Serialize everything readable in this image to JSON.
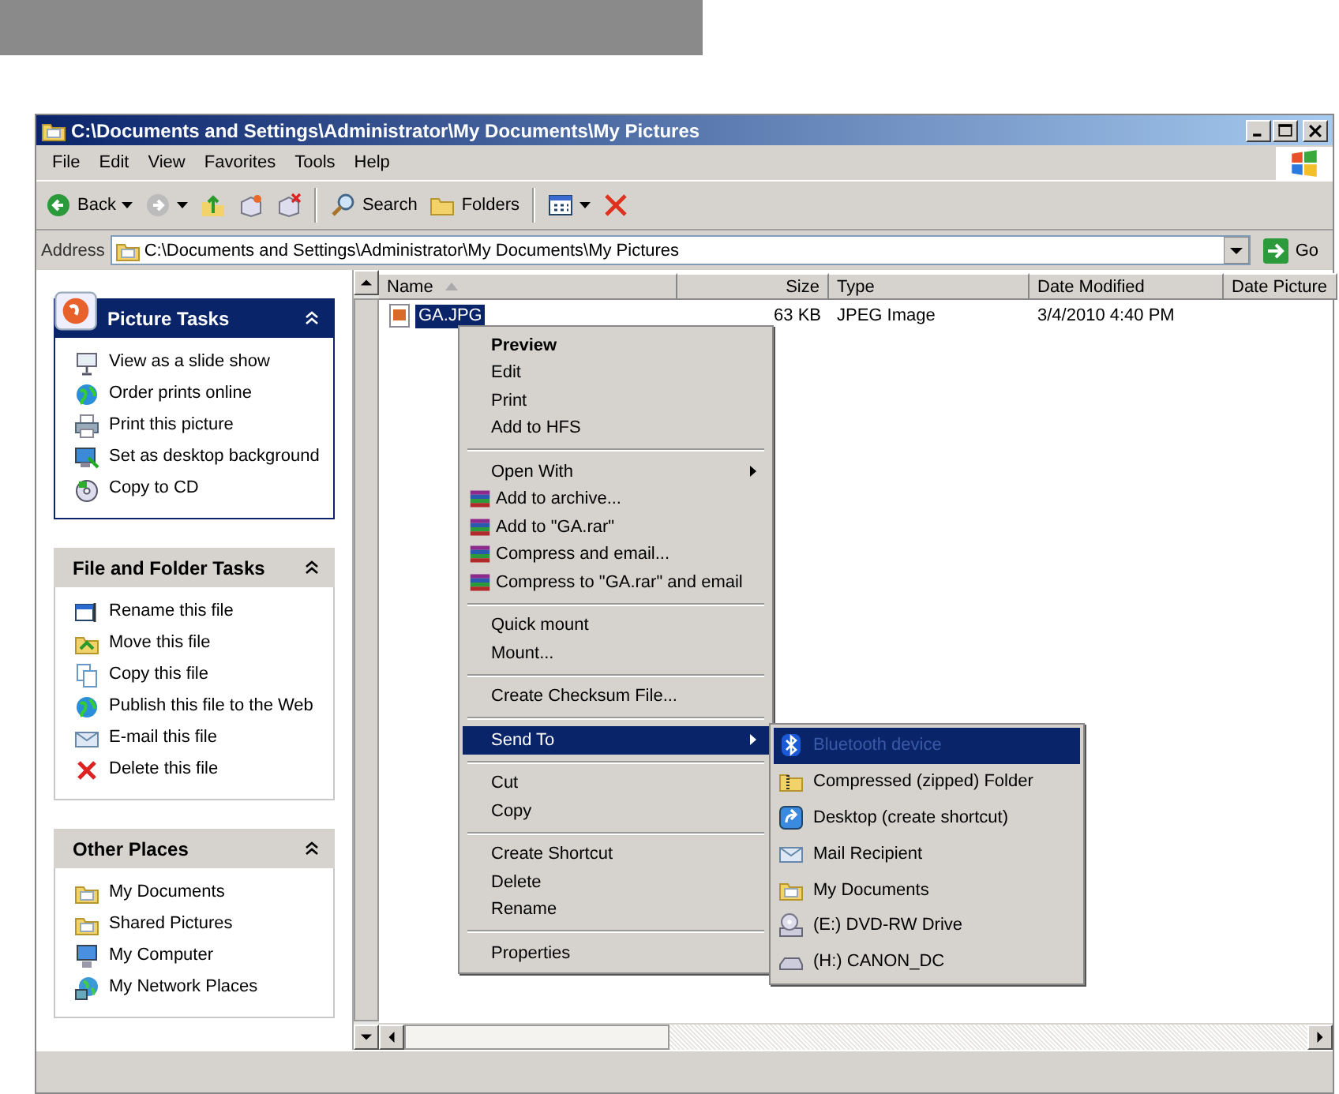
{
  "window": {
    "title": "C:\\Documents and Settings\\Administrator\\My Documents\\My Pictures"
  },
  "menu_bar": [
    "File",
    "Edit",
    "View",
    "Favorites",
    "Tools",
    "Help"
  ],
  "toolbar": [
    {
      "kind": "back",
      "label": "Back",
      "dropdown": true
    },
    {
      "kind": "forward",
      "dropdown": true
    },
    {
      "kind": "up"
    },
    {
      "kind": "move"
    },
    {
      "kind": "copyto"
    },
    {
      "kind": "separator"
    },
    {
      "kind": "search",
      "label": "Search"
    },
    {
      "kind": "folders",
      "label": "Folders"
    },
    {
      "kind": "separator"
    },
    {
      "kind": "views",
      "dropdown": true
    },
    {
      "kind": "delete"
    }
  ],
  "address_bar": {
    "label": "Address",
    "value": "C:\\Documents and Settings\\Administrator\\My Documents\\My Pictures",
    "go": "Go"
  },
  "task_panes": [
    {
      "title": "Picture Tasks",
      "kind": "special",
      "expanded": true,
      "items": [
        {
          "label": "View as a slide show",
          "kind": "slideshow"
        },
        {
          "label": "Order prints online",
          "kind": "globe"
        },
        {
          "label": "Print this picture",
          "kind": "print"
        },
        {
          "label": "Set as desktop background",
          "kind": "desktop"
        },
        {
          "label": "Copy to CD",
          "kind": "cd"
        }
      ]
    },
    {
      "title": "File and Folder Tasks",
      "kind": "normal",
      "expanded": true,
      "items": [
        {
          "label": "Rename this file",
          "kind": "rename"
        },
        {
          "label": "Move this file",
          "kind": "move"
        },
        {
          "label": "Copy this file",
          "kind": "copy"
        },
        {
          "label": "Publish this file to the Web",
          "kind": "globe"
        },
        {
          "label": "E-mail this file",
          "kind": "mail"
        },
        {
          "label": "Delete this file",
          "kind": "delete"
        }
      ]
    },
    {
      "title": "Other Places",
      "kind": "normal",
      "expanded": true,
      "items": [
        {
          "label": "My Documents",
          "kind": "folder"
        },
        {
          "label": "Shared Pictures",
          "kind": "folder"
        },
        {
          "label": "My Computer",
          "kind": "computer"
        },
        {
          "label": "My Network Places",
          "kind": "network"
        }
      ]
    }
  ],
  "file_list": {
    "columns": [
      {
        "label": "Name",
        "sorted": true
      },
      {
        "label": "Size",
        "sorted": false
      },
      {
        "label": "Type",
        "sorted": false
      },
      {
        "label": "Date Modified",
        "sorted": false
      },
      {
        "label": "Date Picture",
        "sorted": false
      }
    ],
    "rows": [
      {
        "name": "GA.JPG",
        "size": "63 KB",
        "type": "JPEG Image",
        "date_modified": "3/4/2010 4:40 PM",
        "selected": true
      }
    ]
  },
  "context_menu": {
    "groups": [
      [
        {
          "label": "Preview",
          "bold": true,
          "kind": "plain",
          "submenu": false,
          "selected": false
        },
        {
          "label": "Edit",
          "bold": false,
          "kind": "plain",
          "submenu": false,
          "selected": false
        },
        {
          "label": "Print",
          "bold": false,
          "kind": "plain",
          "submenu": false,
          "selected": false
        },
        {
          "label": "Add to HFS",
          "bold": false,
          "kind": "plain",
          "submenu": false,
          "selected": false
        }
      ],
      [
        {
          "label": "Open With",
          "bold": false,
          "kind": "plain",
          "submenu": true,
          "selected": false
        },
        {
          "label": "Add to archive...",
          "bold": false,
          "kind": "archive",
          "submenu": false,
          "selected": false
        },
        {
          "label": "Add to \"GA.rar\"",
          "bold": false,
          "kind": "archive",
          "submenu": false,
          "selected": false
        },
        {
          "label": "Compress and email...",
          "bold": false,
          "kind": "archive",
          "submenu": false,
          "selected": false
        },
        {
          "label": "Compress to \"GA.rar\" and email",
          "bold": false,
          "kind": "archive",
          "submenu": false,
          "selected": false
        }
      ],
      [
        {
          "label": "Quick mount",
          "bold": false,
          "kind": "plain",
          "submenu": false,
          "selected": false
        },
        {
          "label": "Mount...",
          "bold": false,
          "kind": "plain",
          "submenu": false,
          "selected": false
        }
      ],
      [
        {
          "label": "Create Checksum File...",
          "bold": false,
          "kind": "plain",
          "submenu": false,
          "selected": false
        }
      ],
      [
        {
          "label": "Send To",
          "bold": false,
          "kind": "plain",
          "submenu": true,
          "selected": true
        }
      ],
      [
        {
          "label": "Cut",
          "bold": false,
          "kind": "plain",
          "submenu": false,
          "selected": false
        },
        {
          "label": "Copy",
          "bold": false,
          "kind": "plain",
          "submenu": false,
          "selected": false
        }
      ],
      [
        {
          "label": "Create Shortcut",
          "bold": false,
          "kind": "plain",
          "submenu": false,
          "selected": false
        },
        {
          "label": "Delete",
          "bold": false,
          "kind": "plain",
          "submenu": false,
          "selected": false
        },
        {
          "label": "Rename",
          "bold": false,
          "kind": "plain",
          "submenu": false,
          "selected": false
        }
      ],
      [
        {
          "label": "Properties",
          "bold": false,
          "kind": "plain",
          "submenu": false,
          "selected": false
        }
      ]
    ]
  },
  "send_to_menu": {
    "items": [
      {
        "label": "Bluetooth device",
        "kind": "bluetooth",
        "selected": true
      },
      {
        "label": "Compressed (zipped) Folder",
        "kind": "zip",
        "selected": false
      },
      {
        "label": "Desktop (create shortcut)",
        "kind": "shortcut",
        "selected": false
      },
      {
        "label": "Mail Recipient",
        "kind": "mail",
        "selected": false
      },
      {
        "label": "My Documents",
        "kind": "folder",
        "selected": false
      },
      {
        "label": "(E:) DVD-RW Drive",
        "kind": "dvd",
        "selected": false
      },
      {
        "label": "(H:) CANON_DC",
        "kind": "drive",
        "selected": false
      }
    ]
  }
}
